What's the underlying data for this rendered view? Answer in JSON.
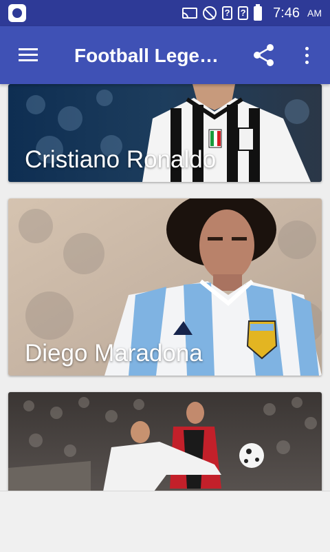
{
  "status_bar": {
    "time": "7:46",
    "ampm": "AM",
    "signal_badge": "?"
  },
  "toolbar": {
    "title": "Football Legends",
    "icons": [
      "menu-icon",
      "share-icon",
      "more-vert-icon"
    ]
  },
  "legends": [
    {
      "name": "Cristiano Ronaldo"
    },
    {
      "name": "Diego Maradona"
    },
    {
      "name": ""
    }
  ]
}
